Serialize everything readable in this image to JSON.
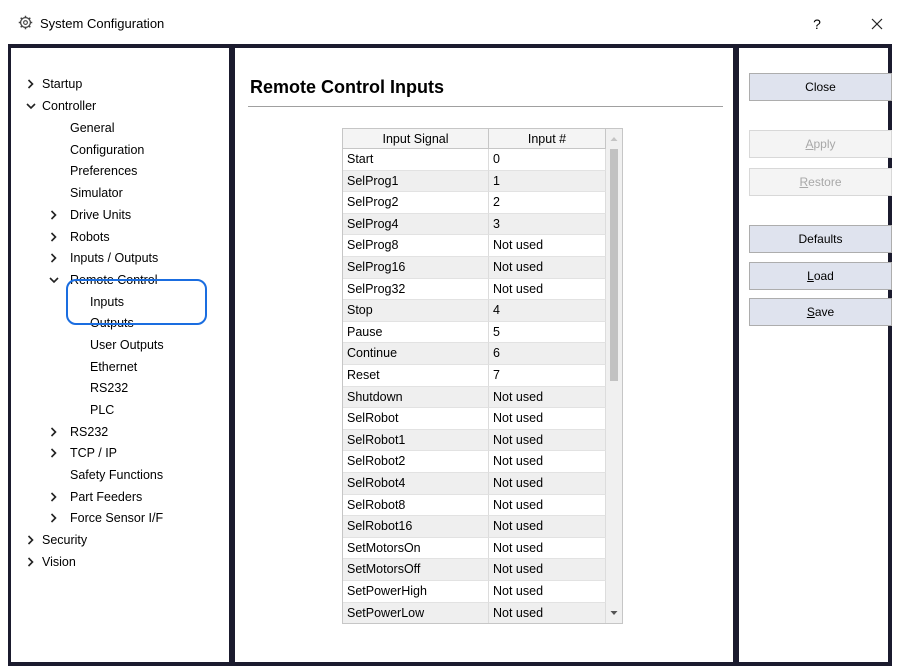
{
  "window": {
    "title": "System Configuration",
    "help_label": "?",
    "close_label": "✕"
  },
  "tree": {
    "items": [
      {
        "label": "Startup",
        "arrow": "chevron-right"
      },
      {
        "label": "Controller",
        "arrow": "chevron-down"
      },
      {
        "label": "General"
      },
      {
        "label": "Configuration"
      },
      {
        "label": "Preferences"
      },
      {
        "label": "Simulator"
      },
      {
        "label": "Drive Units",
        "arrow": "chevron-right"
      },
      {
        "label": "Robots",
        "arrow": "chevron-right"
      },
      {
        "label": "Inputs / Outputs",
        "arrow": "chevron-right"
      },
      {
        "label": "Remote Control",
        "arrow": "chevron-down"
      },
      {
        "label": "Inputs"
      },
      {
        "label": "Outputs"
      },
      {
        "label": "User Outputs"
      },
      {
        "label": "Ethernet"
      },
      {
        "label": "RS232"
      },
      {
        "label": "PLC"
      },
      {
        "label": "RS232",
        "arrow": "chevron-right"
      },
      {
        "label": "TCP / IP",
        "arrow": "chevron-right"
      },
      {
        "label": "Safety Functions"
      },
      {
        "label": "Part Feeders",
        "arrow": "chevron-right"
      },
      {
        "label": "Force Sensor I/F",
        "arrow": "chevron-right"
      },
      {
        "label": "Security",
        "arrow": "chevron-right"
      },
      {
        "label": "Vision",
        "arrow": "chevron-right"
      }
    ]
  },
  "main": {
    "title": "Remote Control Inputs",
    "columns": [
      "Input Signal",
      "Input #"
    ],
    "rows": [
      [
        "Start",
        "0"
      ],
      [
        "SelProg1",
        "1"
      ],
      [
        "SelProg2",
        "2"
      ],
      [
        "SelProg4",
        "3"
      ],
      [
        "SelProg8",
        "Not used"
      ],
      [
        "SelProg16",
        "Not used"
      ],
      [
        "SelProg32",
        "Not used"
      ],
      [
        "Stop",
        "4"
      ],
      [
        "Pause",
        "5"
      ],
      [
        "Continue",
        "6"
      ],
      [
        "Reset",
        "7"
      ],
      [
        "Shutdown",
        "Not used"
      ],
      [
        "SelRobot",
        "Not used"
      ],
      [
        "SelRobot1",
        "Not used"
      ],
      [
        "SelRobot2",
        "Not used"
      ],
      [
        "SelRobot4",
        "Not used"
      ],
      [
        "SelRobot8",
        "Not used"
      ],
      [
        "SelRobot16",
        "Not used"
      ],
      [
        "SetMotorsOn",
        "Not used"
      ],
      [
        "SetMotorsOff",
        "Not used"
      ],
      [
        "SetPowerHigh",
        "Not used"
      ],
      [
        "SetPowerLow",
        "Not used"
      ]
    ]
  },
  "buttons": {
    "close": "Close",
    "apply": "Apply",
    "restore": "Restore",
    "defaults": "Defaults",
    "load": "Load",
    "save": "Save"
  },
  "colors": {
    "frame": "#1b1b2e",
    "button": "#dfe3ee",
    "highlight": "#1a6de0"
  }
}
